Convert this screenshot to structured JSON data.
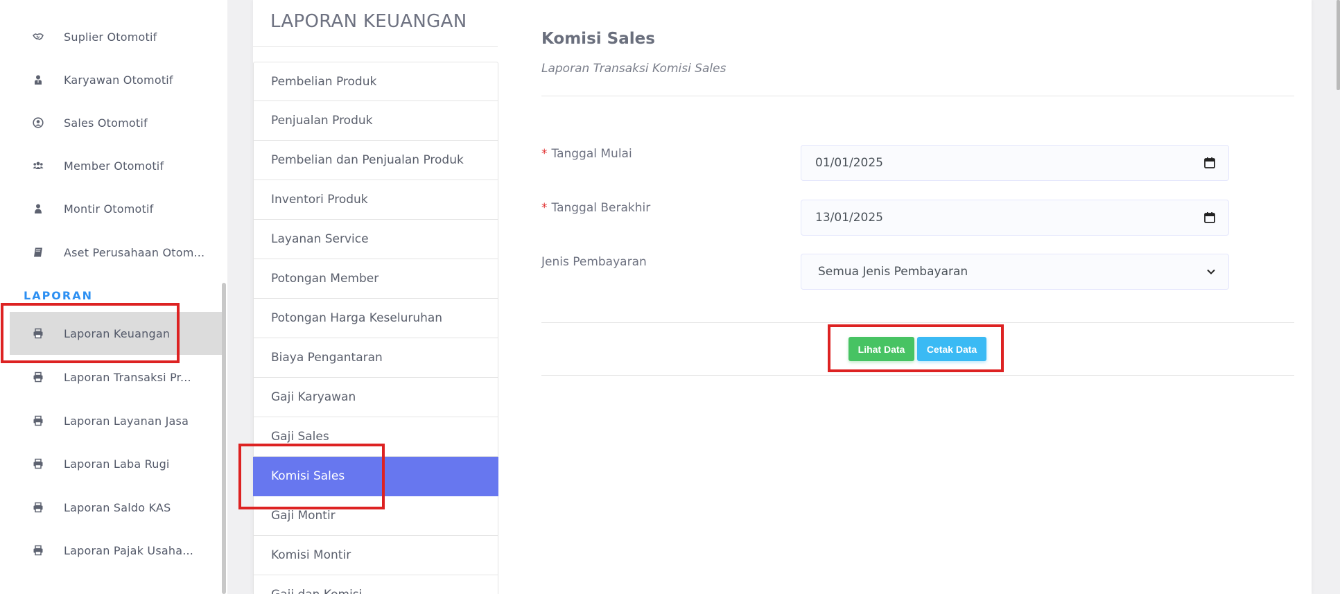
{
  "sidebar": {
    "items": [
      {
        "label": "Suplier Otomotif",
        "icon": "handshake-icon"
      },
      {
        "label": "Karyawan Otomotif",
        "icon": "user-tie-icon"
      },
      {
        "label": "Sales Otomotif",
        "icon": "user-circle-icon"
      },
      {
        "label": "Member Otomotif",
        "icon": "users-icon"
      },
      {
        "label": "Montir Otomotif",
        "icon": "user-icon"
      },
      {
        "label": "Aset Perusahaan Otom...",
        "icon": "book-icon"
      }
    ],
    "section_label": "LAPORAN",
    "report_items": [
      {
        "label": "Laporan Keuangan",
        "icon": "print-icon",
        "active": true
      },
      {
        "label": "Laporan Transaksi Pr...",
        "icon": "print-icon"
      },
      {
        "label": "Laporan Layanan Jasa",
        "icon": "print-icon"
      },
      {
        "label": "Laporan Laba Rugi",
        "icon": "print-icon"
      },
      {
        "label": "Laporan Saldo KAS",
        "icon": "print-icon"
      },
      {
        "label": "Laporan Pajak Usaha...",
        "icon": "print-icon"
      }
    ]
  },
  "card": {
    "title": "LAPORAN KEUANGAN",
    "reports": [
      {
        "label": "Pembelian Produk"
      },
      {
        "label": "Penjualan Produk"
      },
      {
        "label": "Pembelian dan Penjualan Produk"
      },
      {
        "label": "Inventori Produk"
      },
      {
        "label": "Layanan Service"
      },
      {
        "label": "Potongan Member"
      },
      {
        "label": "Potongan Harga Keseluruhan"
      },
      {
        "label": "Biaya Pengantaran"
      },
      {
        "label": "Gaji Karyawan"
      },
      {
        "label": "Gaji Sales"
      },
      {
        "label": "Komisi Sales",
        "active": true
      },
      {
        "label": "Gaji Montir"
      },
      {
        "label": "Komisi Montir"
      },
      {
        "label": "Gaji dan Komisi"
      }
    ]
  },
  "form": {
    "title": "Komisi Sales",
    "subtitle": "Laporan Transaksi Komisi Sales",
    "required_mark": "*",
    "start_date": {
      "label": "Tanggal Mulai",
      "value": "01/01/2025",
      "icon": "calendar-icon"
    },
    "end_date": {
      "label": "Tanggal Berakhir",
      "value": "13/01/2025",
      "icon": "calendar-icon"
    },
    "payment_type": {
      "label": "Jenis Pembayaran",
      "value": "Semua Jenis Pembayaran",
      "icon": "chevron-down-icon"
    },
    "buttons": {
      "view": "Lihat Data",
      "print": "Cetak Data"
    }
  },
  "colors": {
    "accent": "#6777ef",
    "success": "#47c363",
    "info": "#3abaf4",
    "section": "#2c8ff2",
    "annotation": "#dd2222"
  }
}
